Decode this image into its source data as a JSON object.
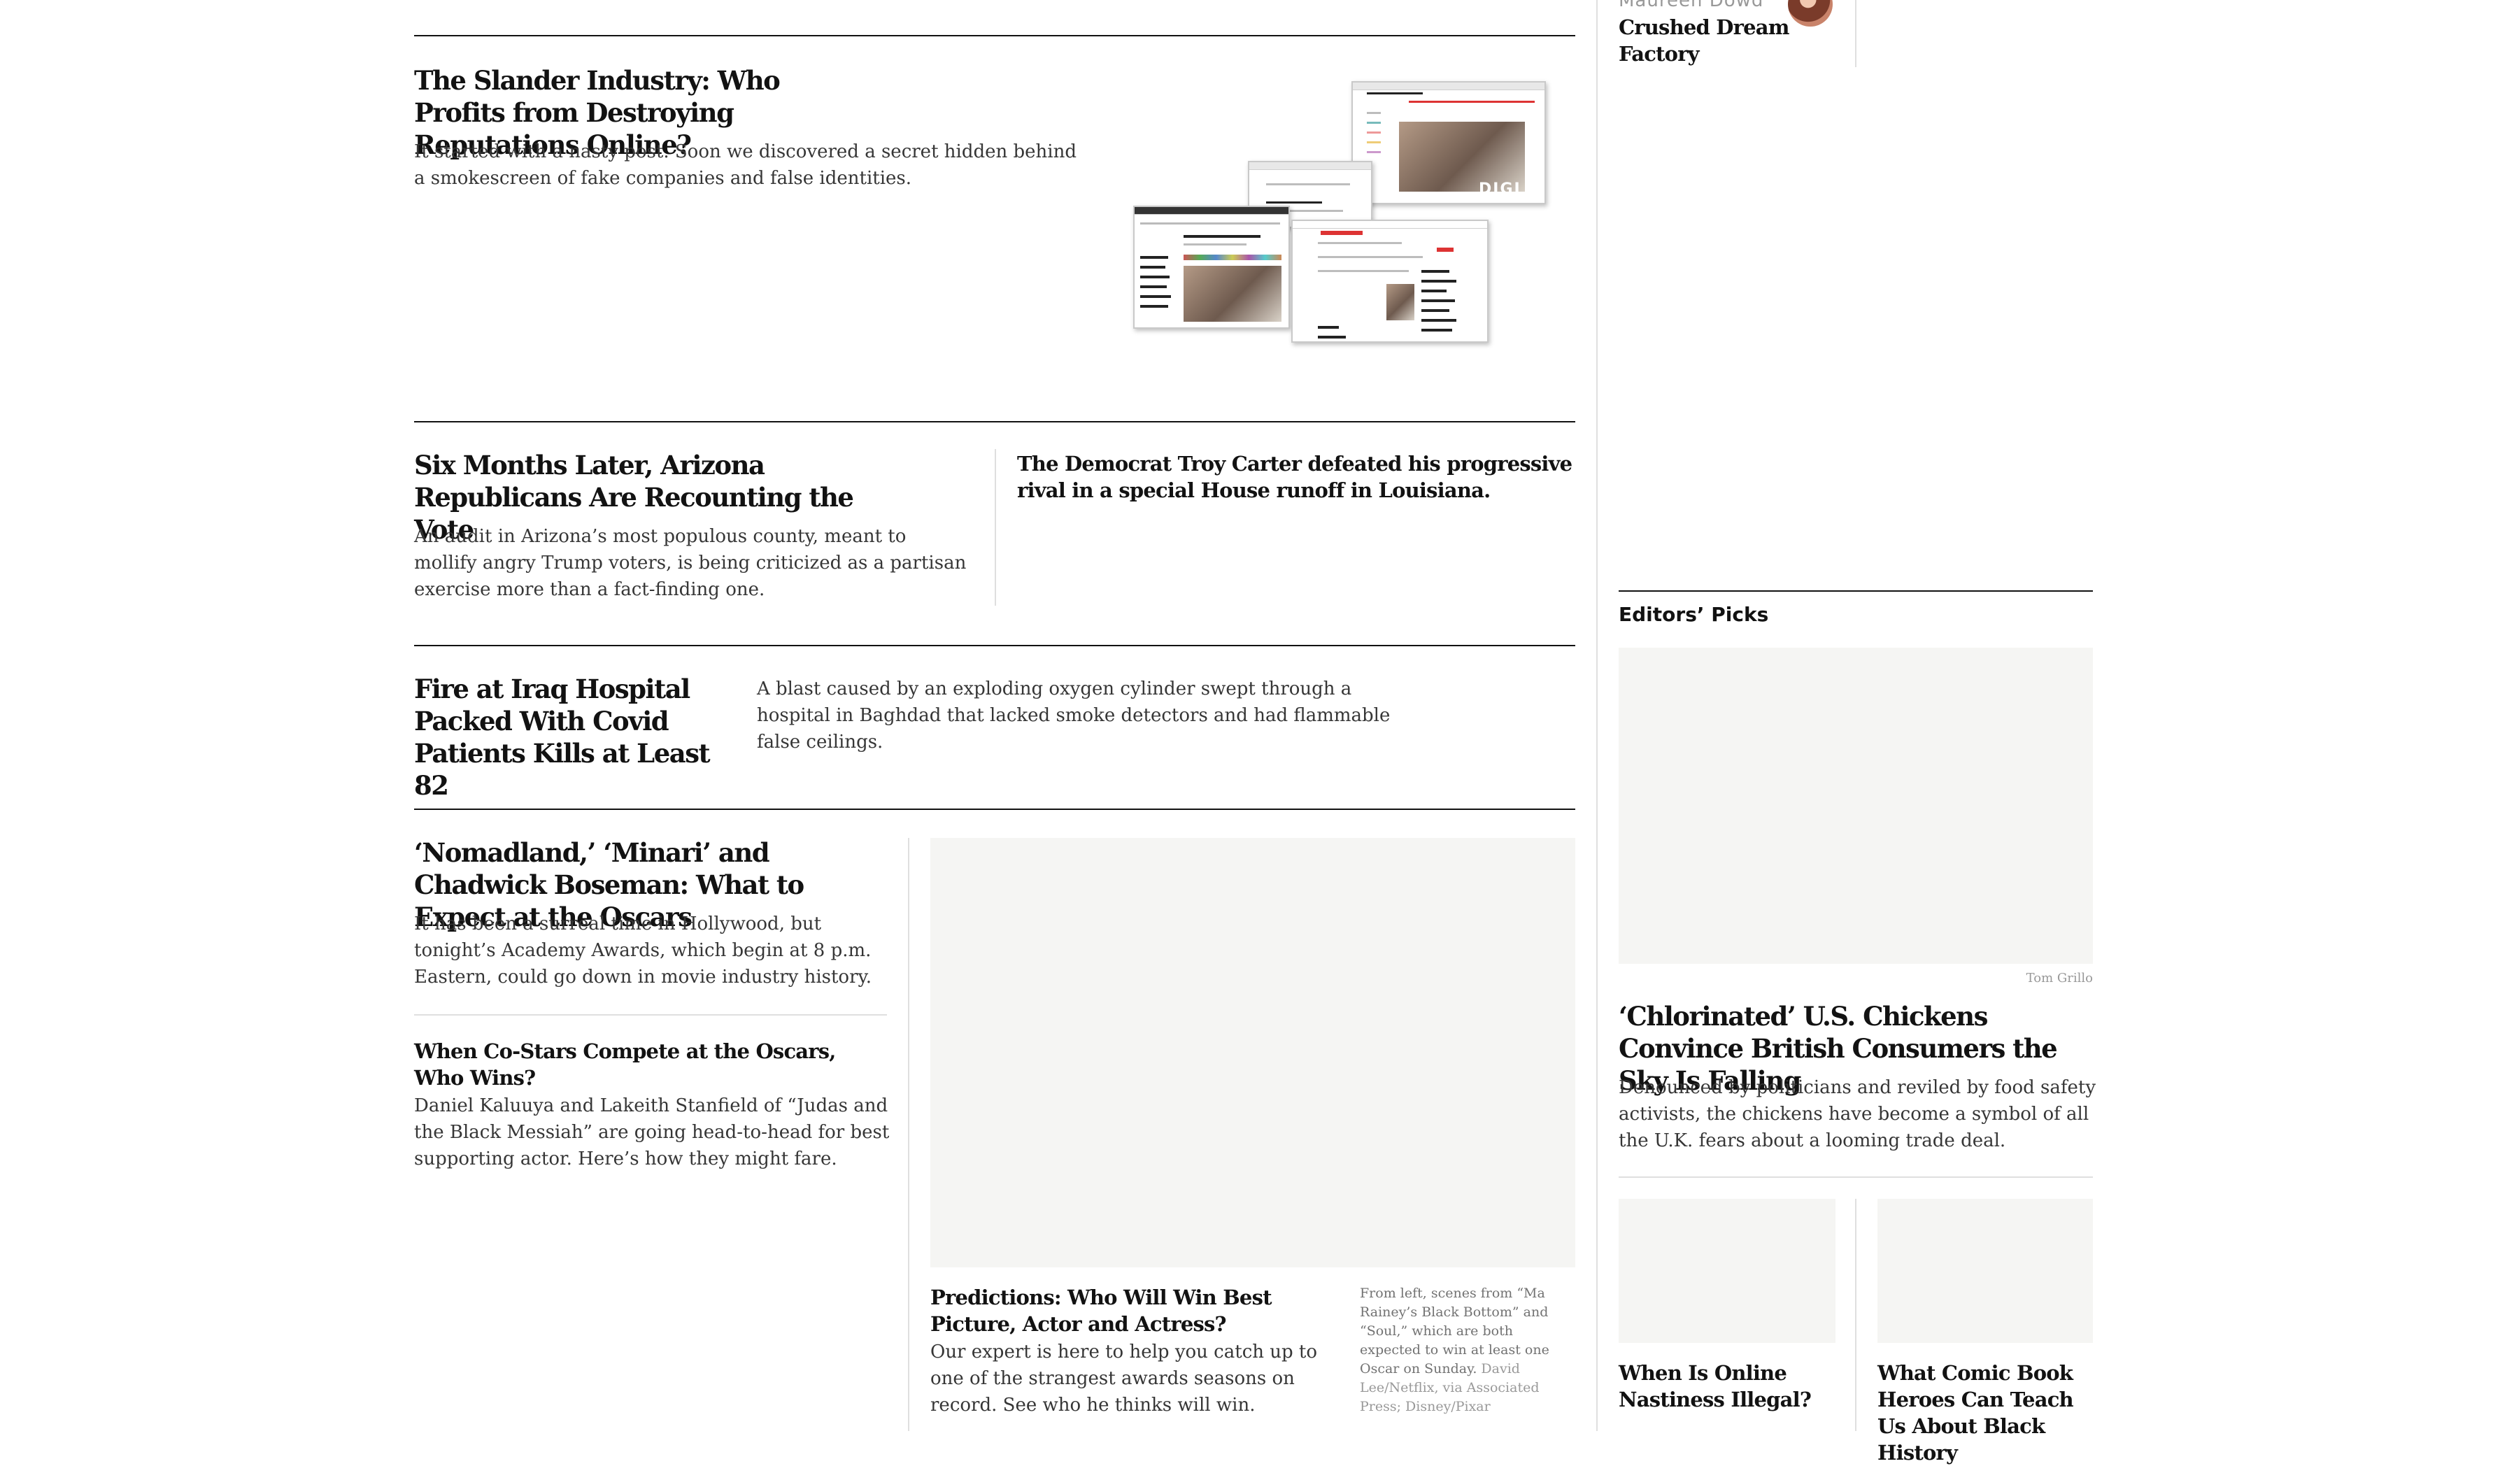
{
  "sidebar_top": {
    "partial_byline": "Maureen Dowd",
    "headline": "Crushed Dream Factory"
  },
  "story_slander": {
    "headline": "The Slander Industry: Who Profits from Destroying Reputations Online?",
    "summary": "It started with a nasty post. Soon we discovered a secret hidden behind a smokescreen of fake companies and false identities."
  },
  "story_arizona": {
    "headline": "Six Months Later, Arizona Republicans Are Recounting the Vote",
    "summary": "An audit in Arizona’s most populous county, meant to mollify angry Trump voters, is being criticized as a partisan exercise more than a fact-finding one."
  },
  "story_louisiana": {
    "headline": "The Democrat Troy Carter defeated his progressive rival in a special House runoff in Louisiana."
  },
  "story_iraq": {
    "headline": "Fire at Iraq Hospital Packed With Covid Patients Kills at Least 82",
    "summary": "A blast caused by an exploding oxygen cylinder swept through a hospital in Baghdad that lacked smoke detectors and had flammable false ceilings."
  },
  "story_oscars": {
    "headline": "‘Nomadland,’ ‘Minari’ and Chadwick Boseman: What to Expect at the Oscars",
    "summary": "It has been a surreal time in Hollywood, but tonight’s Academy Awards, which begin at 8 p.m. Eastern, could go down in movie industry history."
  },
  "story_costars": {
    "headline": "When Co-Stars Compete at the Oscars, Who Wins?",
    "summary": "Daniel Kaluuya and Lakeith Stanfield of “Judas and the Black Messiah” are going head-to-head for best supporting actor. Here’s how they might fare."
  },
  "story_predictions": {
    "headline": "Predictions: Who Will Win Best Picture, Actor and Actress?",
    "summary": "Our expert is here to help you catch up to one of the strangest awards seasons on record. See who he thinks will win.",
    "caption": "From left, scenes from “Ma Rainey’s Black Bottom” and “Soul,” which are both expected to win at least one Oscar on Sunday.",
    "credit": "David Lee/Netflix, via Associated Press; Disney/Pixar"
  },
  "editors_picks": {
    "label": "Editors’ Picks",
    "image_credit": "Tom Grillo",
    "lead_headline": "‘Chlorinated’ U.S. Chickens Convince British Consumers the Sky Is Falling",
    "lead_summary": "Denounced by politicians and reviled by food safety activists, the chickens have become a symbol of all the U.K. fears about a looming trade deal.",
    "small_1": "When Is Online Nastiness Illegal?",
    "small_2": "What Comic Book Heroes Can Teach Us About Black History"
  },
  "collage_text": {
    "badge": "DIGI"
  }
}
